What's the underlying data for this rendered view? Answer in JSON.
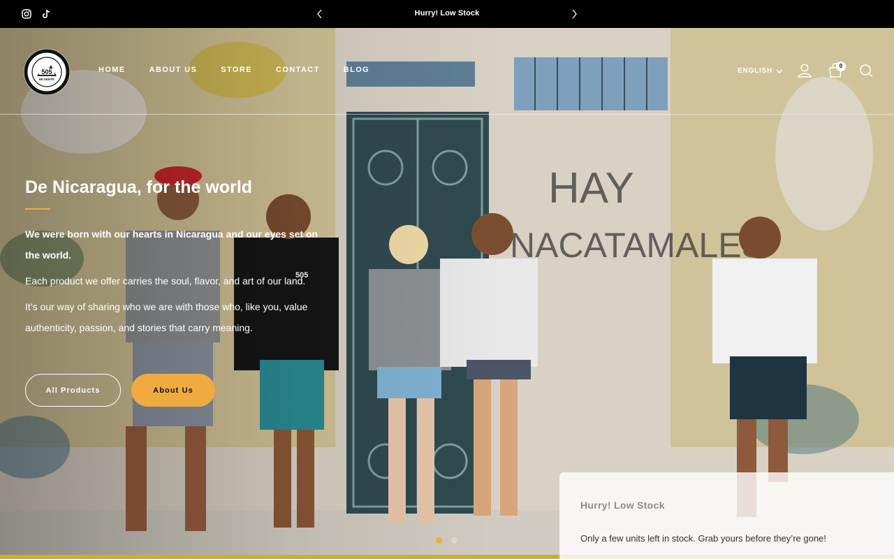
{
  "announcement": {
    "text": "Hurry! Low Stock"
  },
  "social": {
    "icons": [
      "instagram-icon",
      "tiktok-icon"
    ]
  },
  "header": {
    "logo_text": "505",
    "logo_sub": "MI GENTE",
    "nav": [
      "HOME",
      "ABOUT US",
      "STORE",
      "CONTACT",
      "BLOG"
    ],
    "language": "ENGLISH",
    "cart_count": "0"
  },
  "hero": {
    "title": "De Nicaragua, for the world",
    "intro": "We were born with our hearts in Nicaragua and our eyes set on the world.",
    "p1": "Each product we offer carries the soul, flavor, and art of our land.",
    "p2": "It’s our way of sharing who we are with those who, like you, value authenticity, passion, and stories that carry meaning.",
    "btn_all": "All Products",
    "btn_about": "About Us",
    "wall_text_1": "HAY",
    "wall_text_2": "NACATAMALES",
    "shirt_text": "505",
    "slides": 2,
    "active_slide": 1
  },
  "popup": {
    "title": "Hurry! Low Stock",
    "message": "Only a few units left in stock. Grab yours before they’re gone!"
  },
  "colors": {
    "accent": "#f0ab40",
    "topbar": "#000000"
  }
}
